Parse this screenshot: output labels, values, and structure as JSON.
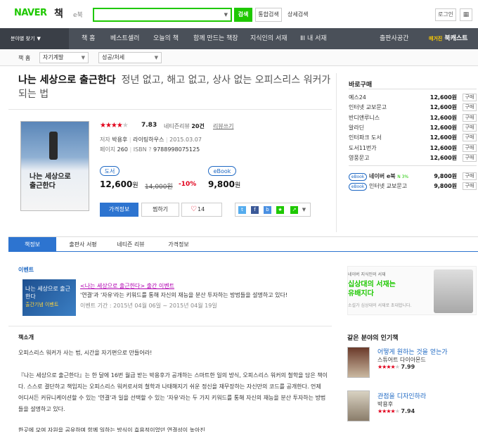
{
  "header": {
    "logo": "NAVER",
    "service": "책",
    "ebook_link": "e북",
    "search_button": "검색",
    "integrated_search": "통합검색",
    "detail_search": "상세검색",
    "login": "로그인",
    "search_placeholder": ""
  },
  "nav": {
    "category": "분야별 찾기",
    "items": [
      "책 홈",
      "베스트셀러",
      "오늘의 책",
      "함께 만드는 책장",
      "지식인의 서재",
      "ⅡⅠ 내 서재",
      "출판사공간"
    ],
    "magazine_badge": "매거진",
    "magazine": "북캐스트"
  },
  "breadcrumb": {
    "home": "책 홈",
    "level1": "자기계발",
    "level2": "성공/처세"
  },
  "book": {
    "title": "나는 세상으로 출근한다",
    "subtitle": "정년 없고, 해고 없고, 상사 없는 오피스리스 워커가 되는 법",
    "cover_text": "나는 세상으로 출근한다",
    "rating": "7.83",
    "review_label": "네티즌리뷰",
    "review_count": "20건",
    "review_write": "리뷰쓰기",
    "author_label": "저자",
    "author": "박용후",
    "publisher": "라이팅하우스",
    "date": "2015.03.07",
    "pages_label": "페이지",
    "pages": "260",
    "isbn_label": "ISBN",
    "isbn": "9788998075125",
    "print_tag": "도서",
    "ebook_tag": "eBook",
    "price": "12,600",
    "price_unit": "원",
    "original_price": "14,000원",
    "discount": "-10%",
    "ebook_price": "9,800",
    "price_info_btn": "가격정보",
    "wish_btn": "찜하기",
    "like_count": "14",
    "heart": "♡"
  },
  "buy": {
    "title": "바로구매",
    "stores": [
      {
        "name": "예스24",
        "price": "12,600원",
        "btn": "구매"
      },
      {
        "name": "인터넷 교보문고",
        "price": "12,600원",
        "btn": "구매"
      },
      {
        "name": "반디앤루니스",
        "price": "12,600원",
        "btn": "구매"
      },
      {
        "name": "알라딘",
        "price": "12,600원",
        "btn": "구매"
      },
      {
        "name": "인터파크 도서",
        "price": "12,600원",
        "btn": "구매"
      },
      {
        "name": "도서11번가",
        "price": "12,600원",
        "btn": "구매"
      },
      {
        "name": "영풍문고",
        "price": "12,600원",
        "btn": "구매"
      }
    ],
    "ebook_stores": [
      {
        "tag": "eBook",
        "name": "네이버 e북",
        "badge": "N 3%",
        "price": "9,800원",
        "btn": "구매"
      },
      {
        "tag": "eBook",
        "name": "인터넷 교보문고",
        "price": "9,800원",
        "btn": "구매"
      }
    ]
  },
  "tabs": [
    "책정보",
    "출판사 서평",
    "네티즌 리뷰",
    "가격정보"
  ],
  "event": {
    "heading": "이벤트",
    "link": "<나는 세상으로 출근한다> 출간 이벤트",
    "desc": "'연결'과 '자유'라는 키워드를 통해 자신의 재능을 분산 투자하는 방법들을 설명하고 있다!",
    "period": "이벤트 기간 : 2015년 04월 06일 ~ 2015년 04월 19일",
    "img_title": "나는 세상으로 출근한다",
    "img_sub": "출간기념 이벤트"
  },
  "right_box": {
    "small": "네이버 지식인의 서재",
    "title_line1": "십상대의 서재는",
    "title_line2": "유배지다",
    "caption": "소설가 심상대의 서재로 초대합니다."
  },
  "intro": {
    "heading": "책소개",
    "line1": "오피스리스 워커가 사는 법, 시간을 자기편으로 만들어라!",
    "p1": "『나는 세상으로 출근한다』는 한 달에 16번 월급 받는 박용후가 공개하는 스마트한 일의 방식, 오피스리스 워커의 철학을 담은 책이다. 스스로 결단하고 책임지는 오피스리스 워커로서의 철학과 나태해지기 쉬운 정신을 재무장하는 자신만의 코드를 공개한다. 언제 어디서든 커뮤니케이션할 수 있는 '연결'과 일을 선택할 수 있는 '자유'라는 두 가지 키워드를 통해 자신의 재능을 분산 투자하는 방법들을 설명하고 있다.",
    "p2": "한곳에 모여 자원을 공유하며 함께 일하는 방식이 효용적이었던 연결성이 높아진"
  },
  "popular": {
    "title": "같은 분야의 인기책",
    "books": [
      {
        "title": "어떻게 원하는 것을 얻는가",
        "author": "스튜어트 다이아몬드",
        "rating": "7.99"
      },
      {
        "title": "관점을 디자인하라",
        "author": "박용후",
        "rating": "7.94"
      }
    ]
  }
}
